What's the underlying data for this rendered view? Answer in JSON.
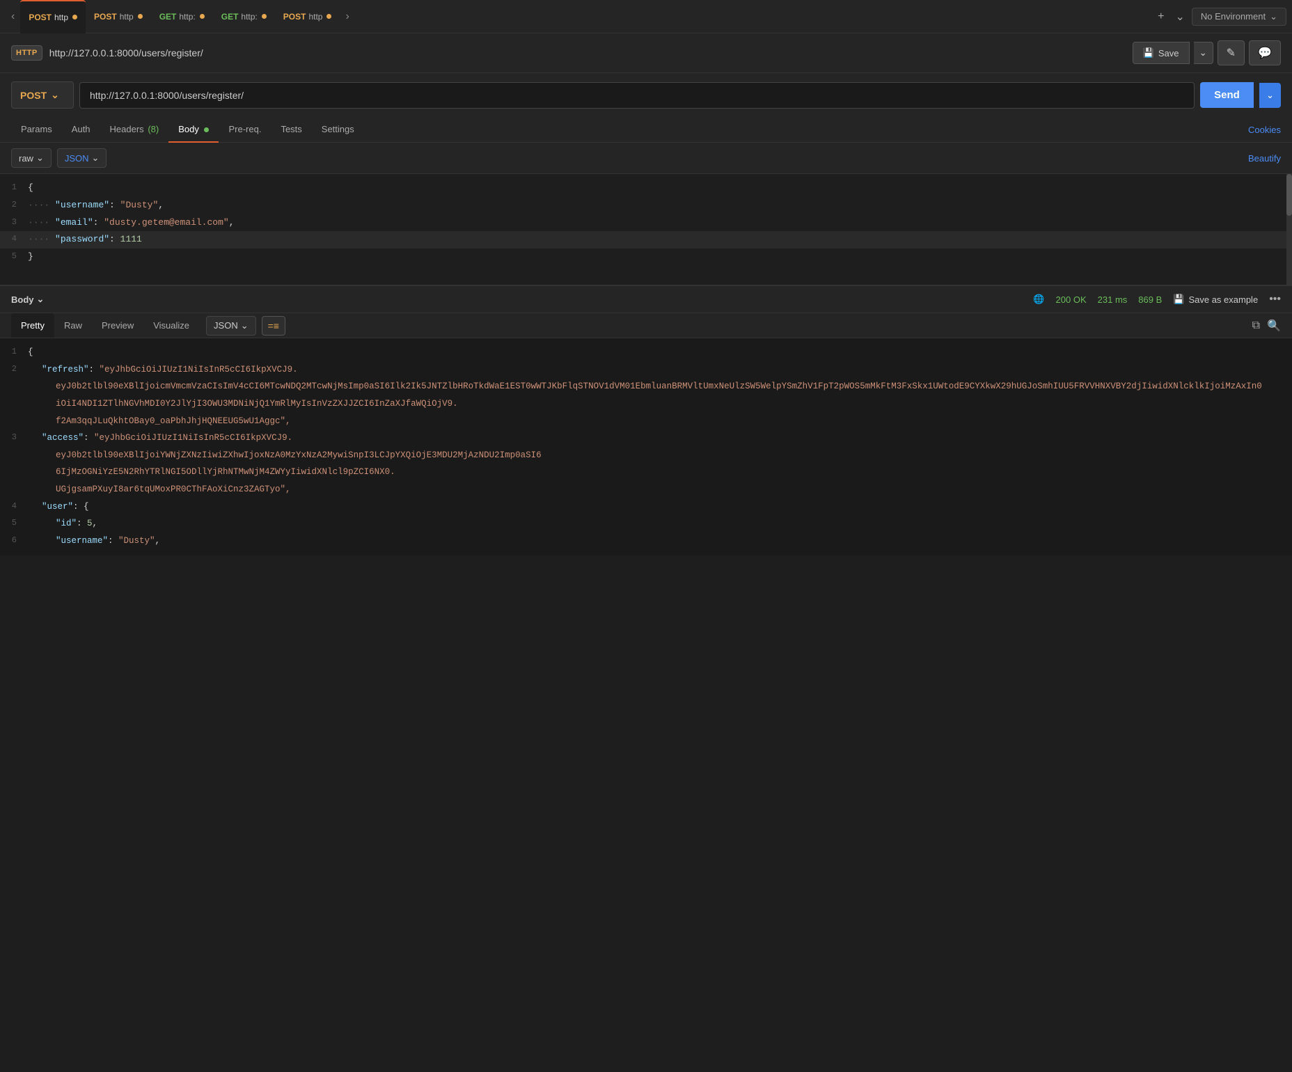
{
  "tabs": [
    {
      "id": "tab1",
      "method": "POST",
      "method_class": "post",
      "url": "http",
      "active": true,
      "has_dot": true
    },
    {
      "id": "tab2",
      "method": "POST",
      "method_class": "post",
      "url": "http",
      "active": false,
      "has_dot": true
    },
    {
      "id": "tab3",
      "method": "GET",
      "method_class": "get",
      "url": "http:",
      "active": false,
      "has_dot": true
    },
    {
      "id": "tab4",
      "method": "GET",
      "method_class": "get",
      "url": "http:",
      "active": false,
      "has_dot": true
    },
    {
      "id": "tab5",
      "method": "POST",
      "method_class": "post",
      "url": "http",
      "active": false,
      "has_dot": true
    }
  ],
  "environment": "No Environment",
  "url_bar": {
    "url": "http://127.0.0.1:8000/users/register/",
    "save_label": "Save"
  },
  "request": {
    "method": "POST",
    "url": "http://127.0.0.1:8000/users/register/",
    "send_label": "Send"
  },
  "request_tabs": [
    {
      "label": "Params",
      "active": false
    },
    {
      "label": "Auth",
      "active": false
    },
    {
      "label": "Headers",
      "count": "(8)",
      "active": false
    },
    {
      "label": "Body",
      "active": true,
      "has_dot": true
    },
    {
      "label": "Pre-req.",
      "active": false
    },
    {
      "label": "Tests",
      "active": false
    },
    {
      "label": "Settings",
      "active": false
    }
  ],
  "cookies_label": "Cookies",
  "body_format": {
    "type": "raw",
    "lang": "JSON",
    "beautify_label": "Beautify"
  },
  "request_body_lines": [
    {
      "num": "1",
      "content": "{"
    },
    {
      "num": "2",
      "content": "    \"username\": \"Dusty\","
    },
    {
      "num": "3",
      "content": "    \"email\": \"dusty.getem@email.com\","
    },
    {
      "num": "4",
      "content": "    \"password\": 1111"
    },
    {
      "num": "5",
      "content": "}"
    }
  ],
  "response": {
    "body_label": "Body",
    "status": "200 OK",
    "time": "231 ms",
    "size": "869 B",
    "save_example_label": "Save as example"
  },
  "response_tabs": [
    {
      "label": "Pretty",
      "active": true
    },
    {
      "label": "Raw",
      "active": false
    },
    {
      "label": "Preview",
      "active": false
    },
    {
      "label": "Visualize",
      "active": false
    }
  ],
  "response_format": "JSON",
  "response_lines": [
    {
      "num": "1",
      "content": "{"
    },
    {
      "num": "2",
      "content": "    \"refresh\": \"eyJhbGciOiJIUzI1NiIsInR5cCI6IkpXVCJ9.eyJ0b2tlbl90eXBlIjoicmVmcmVzaCIsImV4cCI6MTcwNDQ2MTcwNjMsImp0aSI6Ilk2Ik5JNTZlbHRoTkdWaE1EST0wWTJKbFlqSTNOV1dVM01EbmluanBRMVltUmxNeUlzSW5WelpYSmZhV1FpT2pWOS5mMkFtM3FxSkx1UWtodE9CYXkwX29hUGJoSmhIUU5FRVVHNXVBY2djIiwidXNlcklkIjoiMzAxIn0"
    },
    {
      "num": "",
      "content": "    eyJ0b2tlbl90eXBlIjoicmVmcmVzaCIsImV4cCI6MTcwNDQ2MTcwNjMsImp0aSI6Ilk2Ik5JNTZlbHRoTkdWaE1EST0wWTJKbFlqSTNOV1dVM01EbmluanBRMVltUmxNeUlzSW5WelpYSmZhV1FpT2pWOS5mMkFtM3FxSkx1UWtodE9CYXkwX29hUGJoSmhIUU5FRVVHNXVBY2djIiwidXNlcklkIjoiMzAxIn0"
    },
    {
      "num": "",
      "content": "    iOiI4NDI1ZTlhNGVhMDI0Y2JlYjI3OWU3MDNiNjQ1YmRlMyIsInVzZXJJZCI6InZaXJfaWQiOjV9."
    },
    {
      "num": "",
      "content": "    f2Am3qqJLuQkhtOBay0_oaPbhJhjHQNEEUG5wU1Aggc\","
    },
    {
      "num": "3",
      "content": "    \"access\": \"eyJhbGciOiJIUzI1NiIsInR5cCI6IkpXVCJ9."
    },
    {
      "num": "",
      "content": "    eyJ0b2tlbl90eXBlIjoiYWNjZXNzIiwiZXhwIjoxNzA0MzYxNzA2MywiSnpI3LCJpYXQiOjE3MDU2MjAzNDU2Imp0aSI6"
    },
    {
      "num": "",
      "content": "    6IjMzOGNiYzE5N2RhYTRlNGI5ODllYjRhNTMwNjM4ZWYyIiwidXNlcl9pZCI6NX0."
    },
    {
      "num": "",
      "content": "    UGjgsamPXuyI8ar6tqUMoxPR0CThFAoXiCnz3ZAGTyo\","
    },
    {
      "num": "4",
      "content": "    \"user\": {"
    },
    {
      "num": "5",
      "content": "        \"id\": 5,"
    },
    {
      "num": "6",
      "content": "        \"username\": \"Dusty\","
    }
  ]
}
